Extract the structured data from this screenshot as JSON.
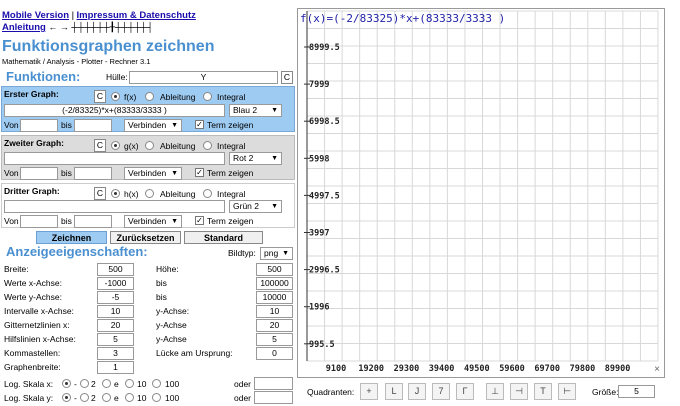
{
  "header": {
    "link_mobile": "Mobile Version",
    "separator": "|",
    "link_impressum": "Impressum & Datenschutz",
    "link_anleitung": "Anleitung",
    "title": "Funktionsgraphen zeichnen",
    "subtitle": "Mathematik / Analysis - Plotter - Rechner 3.1"
  },
  "functions": {
    "heading": "Funktionen:",
    "huelle_label": "Hülle:",
    "huelle_value": "Y",
    "huelle_btn": "C",
    "graphs": [
      {
        "title": "Erster Graph:",
        "c_btn": "C",
        "opt_fx": "f(x)",
        "opt_ableitung": "Ableitung",
        "opt_integral": "Integral",
        "expression": "(-2/83325)*x+(83333/3333 )",
        "color": "Blau 2",
        "von_label": "Von",
        "bis_label": "bis",
        "mode": "Verbinden",
        "term_label": "Term zeigen"
      },
      {
        "title": "Zweiter Graph:",
        "c_btn": "C",
        "opt_fx": "g(x)",
        "opt_ableitung": "Ableitung",
        "opt_integral": "Integral",
        "expression": "",
        "color": "Rot 2",
        "von_label": "Von",
        "bis_label": "bis",
        "mode": "Verbinden",
        "term_label": "Term zeigen"
      },
      {
        "title": "Dritter Graph:",
        "c_btn": "C",
        "opt_fx": "h(x)",
        "opt_ableitung": "Ableitung",
        "opt_integral": "Integral",
        "expression": "",
        "color": "Grün 2",
        "von_label": "Von",
        "bis_label": "bis",
        "mode": "Verbinden",
        "term_label": "Term zeigen"
      }
    ]
  },
  "actions": {
    "zeichnen": "Zeichnen",
    "zuruecksetzen": "Zurücksetzen",
    "standard": "Standard"
  },
  "settings": {
    "heading": "Anzeigeeigenschaften:",
    "bildtyp_label": "Bildtyp:",
    "bildtyp_value": "png",
    "breite_label": "Breite:",
    "breite": "500",
    "hoehe_label": "Höhe:",
    "hoehe": "500",
    "werte_x_label": "Werte x-Achse:",
    "x_min": "-1000",
    "x_bis": "bis",
    "x_max": "100000",
    "werte_y_label": "Werte y-Achse:",
    "y_min": "-5",
    "y_bis": "bis",
    "y_max": "10000",
    "intervalle_label": "Intervalle x-Achse:",
    "intervalle_x": "10",
    "y_achse_label1": "y-Achse:",
    "intervalle_y": "10",
    "gitter_label": "Gitternetzlinien x:",
    "gitter_x": "20",
    "y_achse_label2": "y-Achse",
    "gitter_y": "20",
    "hilfs_label": "Hilfslinien x-Achse:",
    "hilfs_x": "5",
    "y_achse_label3": "y-Achse",
    "hilfs_y": "5",
    "komma_label": "Kommastellen:",
    "komma": "3",
    "luecke_label": "Lücke am Ursprung:",
    "luecke": "0",
    "graphenbreite_label": "Graphenbreite:",
    "graphenbreite": "1",
    "logx_label": "Log. Skala x:",
    "logy_label": "Log. Skala y:",
    "log_opts": [
      "-",
      "2",
      "e",
      "10",
      "100"
    ],
    "oder_label": "oder"
  },
  "plot": {
    "formula": "f(x)=(-2/83325)*x+(83333/3333 )",
    "y_ticks": [
      "8999.5",
      "7999",
      "6998.5",
      "5998",
      "4997.5",
      "3997",
      "2996.5",
      "1996",
      "995.5"
    ],
    "x_ticks": [
      "9100",
      "19200",
      "29300",
      "39400",
      "49500",
      "59600",
      "69700",
      "79800",
      "89900"
    ],
    "close_glyph": "×"
  },
  "footer": {
    "quadranten_label": "Quadranten:",
    "quadrant_icons": [
      "+",
      "L",
      "J",
      "7",
      "Γ",
      "⊥",
      "⊣",
      "T",
      "⊢"
    ],
    "groesse_label": "Größe:",
    "groesse_value": "5"
  }
}
